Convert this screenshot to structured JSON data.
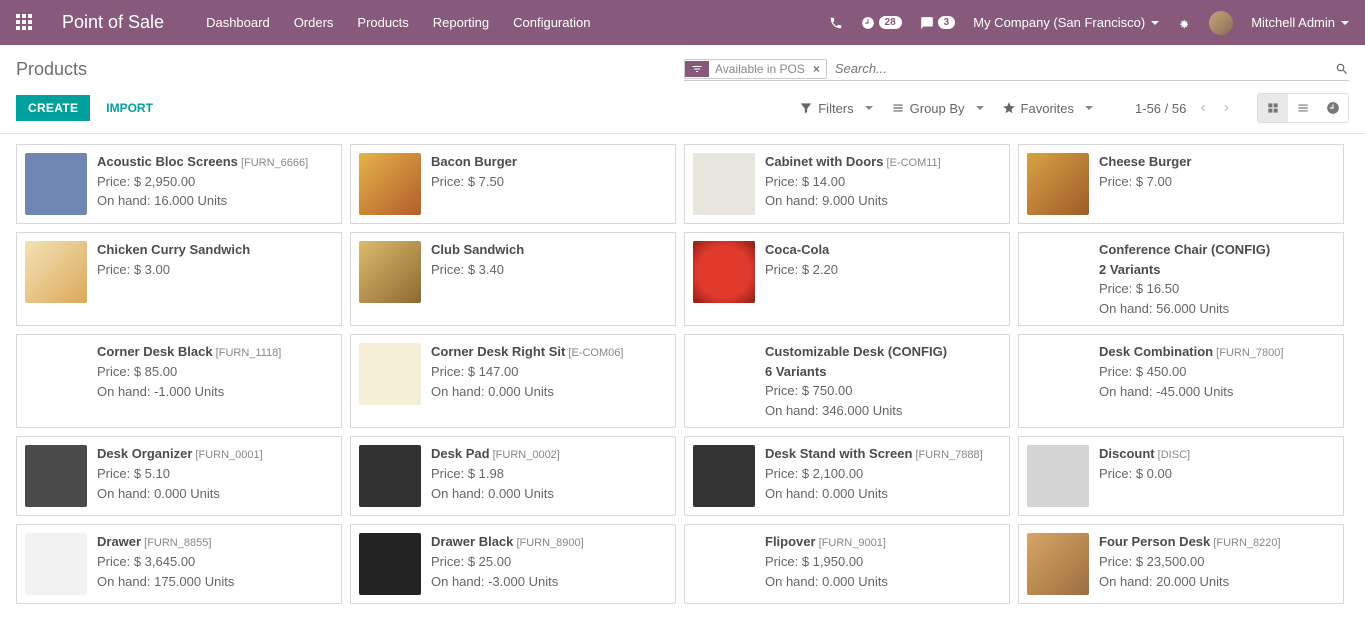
{
  "nav": {
    "brand": "Point of Sale",
    "menu": [
      "Dashboard",
      "Orders",
      "Products",
      "Reporting",
      "Configuration"
    ],
    "msg_count": "28",
    "chat_count": "3",
    "company": "My Company (San Francisco)",
    "user": "Mitchell Admin"
  },
  "breadcrumb": "Products",
  "search": {
    "facet_label": "Available in POS",
    "placeholder": "Search..."
  },
  "cp": {
    "create": "CREATE",
    "import": "IMPORT",
    "filters": "Filters",
    "groupby": "Group By",
    "favorites": "Favorites",
    "pager": "1-56 / 56"
  },
  "price_prefix": "Price: ",
  "onhand_prefix": "On hand: ",
  "products": [
    {
      "name": "Acoustic Bloc Screens",
      "code": "[FURN_6666]",
      "price": "$ 2,950.00",
      "onhand": "16.000 Units",
      "thumb_bg": "#6f85b2"
    },
    {
      "name": "Bacon Burger",
      "code": "",
      "price": "$ 7.50",
      "onhand": "",
      "thumb_bg": "linear-gradient(135deg,#e6b34a,#b25d2a)"
    },
    {
      "name": "Cabinet with Doors",
      "code": "[E-COM11]",
      "price": "$ 14.00",
      "onhand": "9.000 Units",
      "thumb_bg": "#e9e5df"
    },
    {
      "name": "Cheese Burger",
      "code": "",
      "price": "$ 7.00",
      "onhand": "",
      "thumb_bg": "linear-gradient(135deg,#d9a243,#9e5b29)"
    },
    {
      "name": "Chicken Curry Sandwich",
      "code": "",
      "price": "$ 3.00",
      "onhand": "",
      "thumb_bg": "linear-gradient(135deg,#f3e2b5,#dba95a)"
    },
    {
      "name": "Club Sandwich",
      "code": "",
      "price": "$ 3.40",
      "onhand": "",
      "thumb_bg": "linear-gradient(135deg,#dcbb6e,#8d6a30)"
    },
    {
      "name": "Coca-Cola",
      "code": "",
      "price": "$ 2.20",
      "onhand": "",
      "thumb_bg": "radial-gradient(circle,#e03a2d 60%,#8c1d14)"
    },
    {
      "name": "Conference Chair (CONFIG)",
      "code": "",
      "variants": "2 Variants",
      "price": "$ 16.50",
      "onhand": "56.000 Units",
      "thumb_bg": "#ffffff"
    },
    {
      "name": "Corner Desk Black",
      "code": "[FURN_1118]",
      "price": "$ 85.00",
      "onhand": "-1.000 Units",
      "thumb_bg": "#ffffff"
    },
    {
      "name": "Corner Desk Right Sit",
      "code": "[E-COM06]",
      "price": "$ 147.00",
      "onhand": "0.000 Units",
      "thumb_bg": "#f6efd8"
    },
    {
      "name": "Customizable Desk (CONFIG)",
      "code": "",
      "variants": "6 Variants",
      "price": "$ 750.00",
      "onhand": "346.000 Units",
      "thumb_bg": "#ffffff"
    },
    {
      "name": "Desk Combination",
      "code": "[FURN_7800]",
      "price": "$ 450.00",
      "onhand": "-45.000 Units",
      "thumb_bg": "#ffffff"
    },
    {
      "name": "Desk Organizer",
      "code": "[FURN_0001]",
      "price": "$ 5.10",
      "onhand": "0.000 Units",
      "thumb_bg": "#4a4a4a"
    },
    {
      "name": "Desk Pad",
      "code": "[FURN_0002]",
      "price": "$ 1.98",
      "onhand": "0.000 Units",
      "thumb_bg": "#323232"
    },
    {
      "name": "Desk Stand with Screen",
      "code": "[FURN_7888]",
      "price": "$ 2,100.00",
      "onhand": "0.000 Units",
      "thumb_bg": "#333"
    },
    {
      "name": "Discount",
      "code": "[DISC]",
      "price": "$ 0.00",
      "onhand": "",
      "thumb_bg": "#d4d4d4"
    },
    {
      "name": "Drawer",
      "code": "[FURN_8855]",
      "price": "$ 3,645.00",
      "onhand": "175.000 Units",
      "thumb_bg": "#f2f2f2"
    },
    {
      "name": "Drawer Black",
      "code": "[FURN_8900]",
      "price": "$ 25.00",
      "onhand": "-3.000 Units",
      "thumb_bg": "#232323"
    },
    {
      "name": "Flipover",
      "code": "[FURN_9001]",
      "price": "$ 1,950.00",
      "onhand": "0.000 Units",
      "thumb_bg": "#ffffff"
    },
    {
      "name": "Four Person Desk",
      "code": "[FURN_8220]",
      "price": "$ 23,500.00",
      "onhand": "20.000 Units",
      "thumb_bg": "linear-gradient(135deg,#d8a566,#9a6f3e)"
    }
  ]
}
